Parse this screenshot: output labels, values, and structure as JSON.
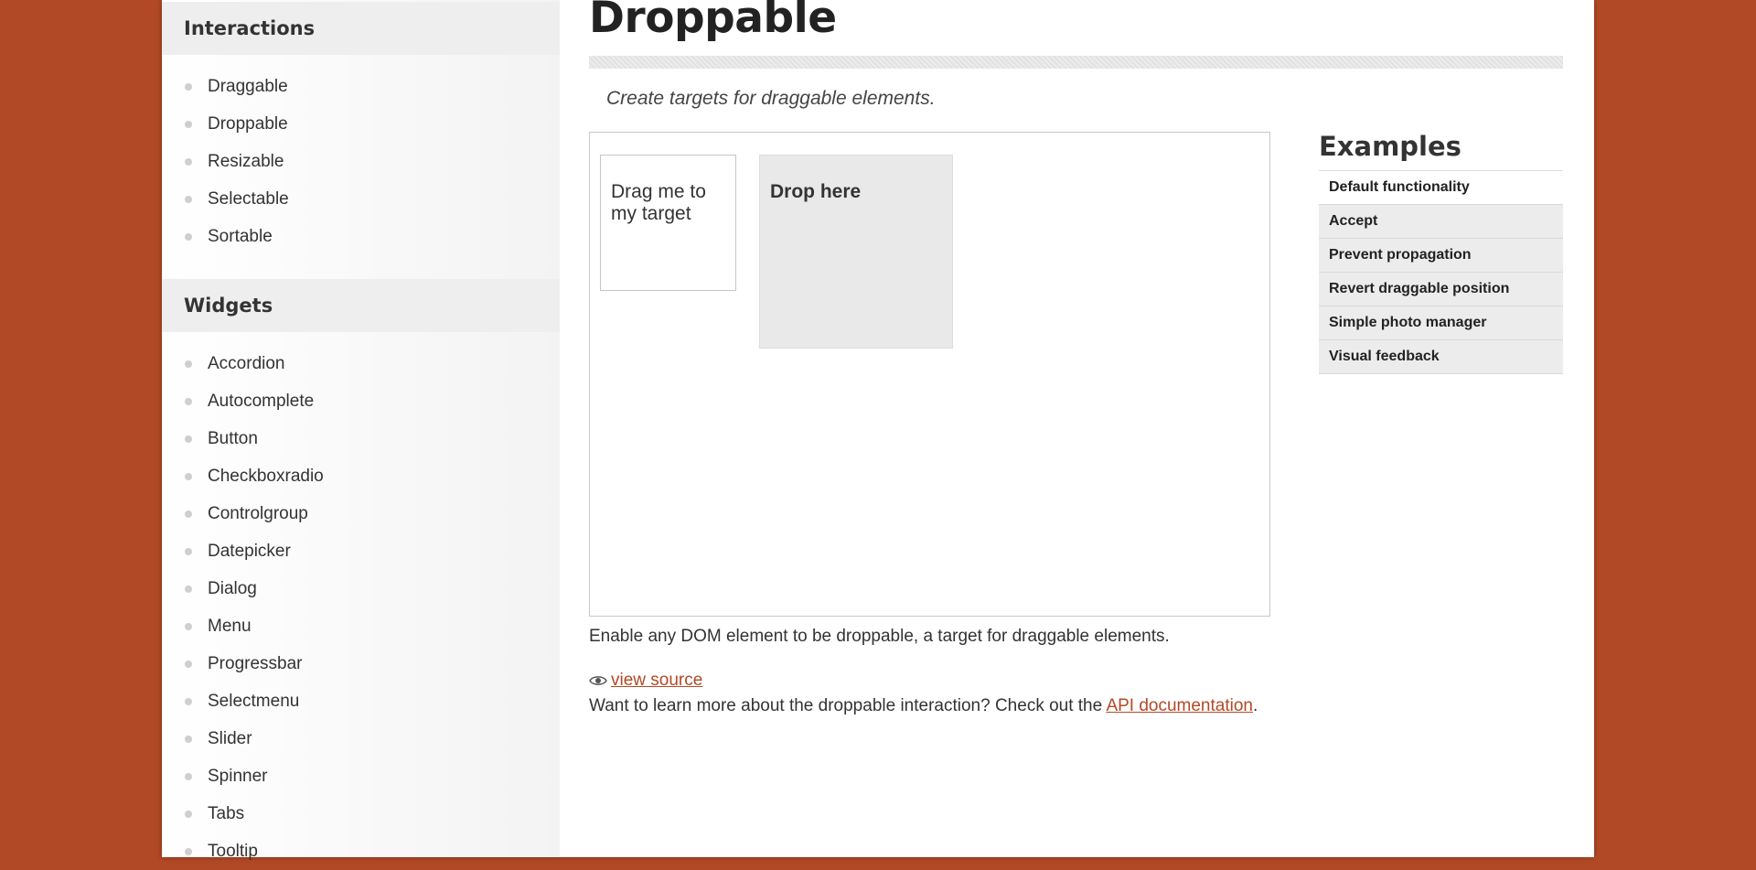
{
  "sidebar": {
    "interactions_heading": "Interactions",
    "interactions": [
      "Draggable",
      "Droppable",
      "Resizable",
      "Selectable",
      "Sortable"
    ],
    "widgets_heading": "Widgets",
    "widgets": [
      "Accordion",
      "Autocomplete",
      "Button",
      "Checkboxradio",
      "Controlgroup",
      "Datepicker",
      "Dialog",
      "Menu",
      "Progressbar",
      "Selectmenu",
      "Slider",
      "Spinner",
      "Tabs",
      "Tooltip"
    ]
  },
  "main": {
    "title": "Droppable",
    "subtitle": "Create targets for draggable elements.",
    "demo": {
      "draggable_text": "Drag me to my target",
      "droppable_text": "Drop here"
    },
    "description": "Enable any DOM element to be droppable, a target for draggable elements.",
    "view_source": "view source",
    "learn_more_prefix": "Want to learn more about the droppable interaction? Check out the ",
    "api_link": "API documentation",
    "learn_more_suffix": "."
  },
  "examples": {
    "heading": "Examples",
    "items": [
      "Default functionality",
      "Accept",
      "Prevent propagation",
      "Revert draggable position",
      "Simple photo manager",
      "Visual feedback"
    ]
  },
  "colors": {
    "accent": "#b24926",
    "page_background": "#b24926"
  }
}
